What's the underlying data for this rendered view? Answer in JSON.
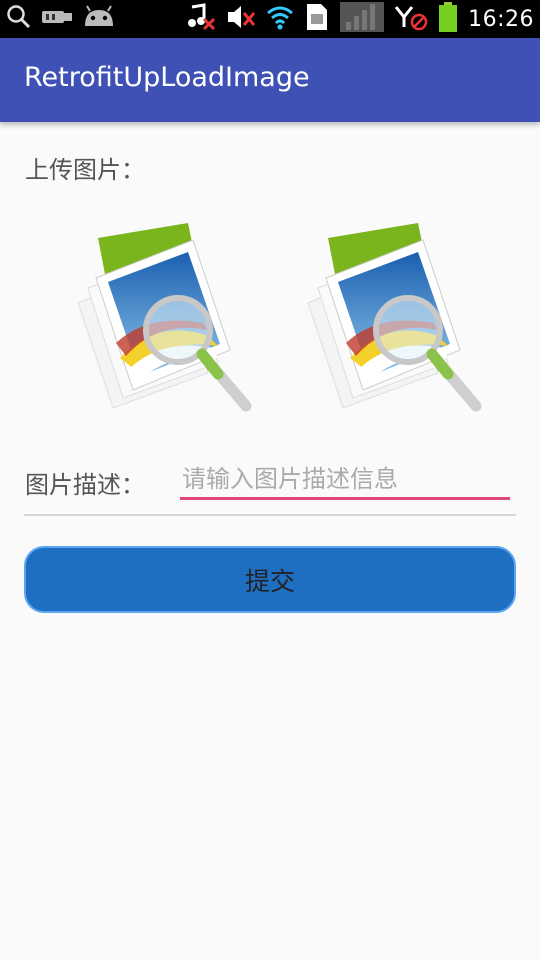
{
  "status_bar": {
    "time": "16:26",
    "icons": [
      "search-icon",
      "usb-icon",
      "android-icon",
      "music-muted-icon",
      "volume-muted-icon",
      "wifi-icon",
      "sim-icon",
      "signal-icon",
      "no-signal-icon",
      "battery-icon"
    ]
  },
  "app_bar": {
    "title": "RetrofitUpLoadImage",
    "color": "#3f51b5"
  },
  "form": {
    "upload_label": "上传图片：",
    "images": [
      {
        "icon": "image-placeholder-icon"
      },
      {
        "icon": "image-placeholder-icon"
      }
    ],
    "description_label": "图片描述：",
    "description_value": "",
    "description_placeholder": "请输入图片描述信息",
    "submit_label": "提交",
    "accent_color": "#e0457b",
    "button_color": "#1e6fc2"
  }
}
